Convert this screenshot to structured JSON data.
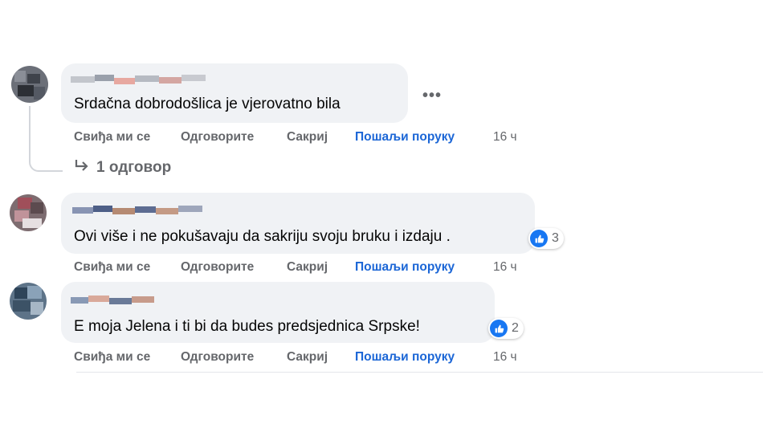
{
  "comments": [
    {
      "text": "Srdačna dobrodošlica je vjerovatno bila",
      "actions": {
        "like": "Свиђа ми се",
        "reply": "Одговорите",
        "hide": "Сакриј",
        "message": "Пошаљи поруку",
        "time": "16 ч"
      },
      "replies_label": "1 одговор",
      "more_label": "•••"
    },
    {
      "text": "Ovi više i ne pokušavaju da sakriju svoju bruku i izdaju .",
      "actions": {
        "like": "Свиђа ми се",
        "reply": "Одговорите",
        "hide": "Сакриј",
        "message": "Пошаљи поруку",
        "time": "16 ч"
      },
      "reaction_count": "3"
    },
    {
      "text": "E moja Jelena i ti bi da budes predsjednica Srpske!",
      "actions": {
        "like": "Свиђа ми се",
        "reply": "Одговорите",
        "hide": "Сакриј",
        "message": "Пошаљи поруку",
        "time": "16 ч"
      },
      "reaction_count": "2"
    }
  ],
  "colors": {
    "bubble": "#f0f2f5",
    "action_text": "#65676b",
    "message_link": "#1b66d6",
    "like_blue": "#1877f2"
  },
  "icons": {
    "reply_arrow": "reply-arrow-icon",
    "like": "like-icon",
    "more": "more-options-icon"
  }
}
